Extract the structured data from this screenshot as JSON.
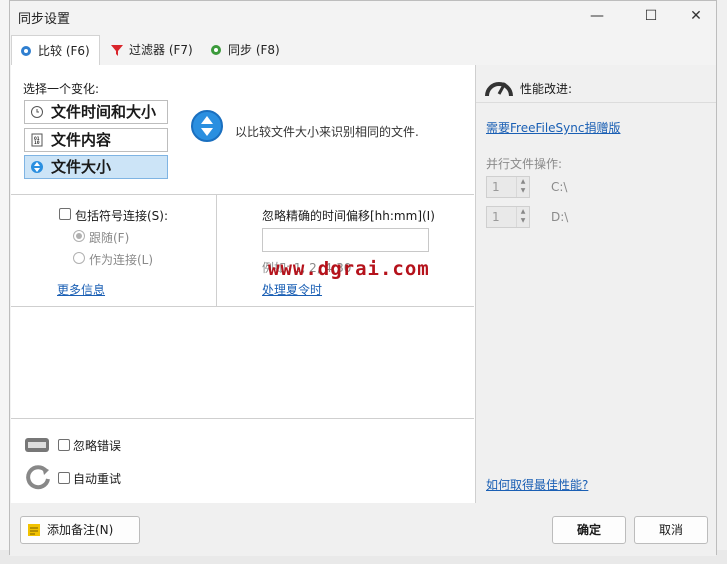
{
  "window": {
    "title": "同步设置"
  },
  "tabs": [
    {
      "label": "比较 (F6)"
    },
    {
      "label": "过滤器 (F7)"
    },
    {
      "label": "同步 (F8)"
    }
  ],
  "compare": {
    "section_label": "选择一个变化:",
    "variants": [
      {
        "label": "文件时间和大小",
        "selected": false
      },
      {
        "label": "文件内容",
        "selected": false
      },
      {
        "label": "文件大小",
        "selected": true
      }
    ],
    "description": "以比较文件大小来识别相同的文件."
  },
  "symlinks": {
    "checkbox_label": "包括符号连接(S):",
    "options": [
      {
        "label": "跟随(F)",
        "selected": true
      },
      {
        "label": "作为连接(L)",
        "selected": false
      }
    ],
    "more_info": "更多信息"
  },
  "time_shift": {
    "label": "忽略精确的时间偏移[hh:mm](I)",
    "value": "",
    "example": "例如: 1, 2, 4:30",
    "dst_link": "处理夏令时"
  },
  "errors": {
    "ignore_label": "忽略错误",
    "retry_label": "自动重试"
  },
  "performance": {
    "title": "性能改进:",
    "donation_link": "需要FreeFileSync捐赠版",
    "parallel_label": "并行文件操作:",
    "drives": [
      {
        "count": "1",
        "drive": "C:\\"
      },
      {
        "count": "1",
        "drive": "D:\\"
      }
    ],
    "best_perf_link": "如何取得最佳性能?"
  },
  "footer": {
    "add_note": "添加备注(N)",
    "ok": "确定",
    "cancel": "取消"
  },
  "watermark": "www.dgrai.com",
  "colors": {
    "accent": "#1a5fb4",
    "selected_bg": "#cce4f7",
    "watermark": "#b5121b"
  }
}
